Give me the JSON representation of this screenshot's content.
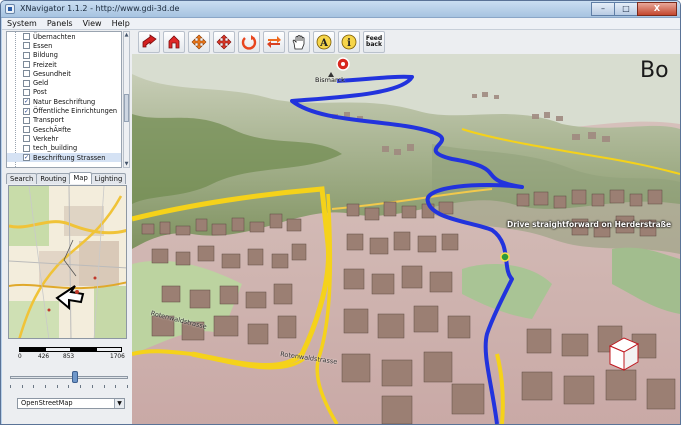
{
  "window": {
    "title": "XNavigator 1.1.2 - http://www.gdi-3d.de",
    "buttons": {
      "minimize": "–",
      "maximize": "□",
      "close": "X"
    }
  },
  "menu": [
    "System",
    "Panels",
    "View",
    "Help"
  ],
  "layers": [
    {
      "label": "Übernachten",
      "checked": false
    },
    {
      "label": "Essen",
      "checked": false
    },
    {
      "label": "Bildung",
      "checked": false
    },
    {
      "label": "Freizeit",
      "checked": false
    },
    {
      "label": "Gesundheit",
      "checked": false
    },
    {
      "label": "Geld",
      "checked": false
    },
    {
      "label": "Post",
      "checked": false
    },
    {
      "label": "Natur Beschriftung",
      "checked": true
    },
    {
      "label": "Öffentliche Einrichtungen",
      "checked": true
    },
    {
      "label": "Transport",
      "checked": false
    },
    {
      "label": "GeschÃ¤fte",
      "checked": false
    },
    {
      "label": "Verkehr",
      "checked": false
    },
    {
      "label": "tech_building",
      "checked": false
    },
    {
      "label": "Beschriftung Strassen",
      "checked": true
    }
  ],
  "tabs": [
    "Search",
    "Routing",
    "Map",
    "Lighting"
  ],
  "active_tab": "Map",
  "scale": {
    "labels": [
      "0",
      "426",
      "853",
      "1706"
    ]
  },
  "slider": {
    "value": 0.55
  },
  "map_source": "OpenStreetMap",
  "toolbar": {
    "buttons": [
      {
        "name": "pan-forward",
        "icon": "red-arrow-icon"
      },
      {
        "name": "pan-up",
        "icon": "red-up-arrow-icon"
      },
      {
        "name": "move",
        "icon": "cross-arrows-icon"
      },
      {
        "name": "move-alt",
        "icon": "cross-arrows-red-icon"
      },
      {
        "name": "rotate",
        "icon": "rotate-icon"
      },
      {
        "name": "swap",
        "icon": "swap-arrows-icon"
      },
      {
        "name": "grab",
        "icon": "hand-icon"
      },
      {
        "name": "annotate",
        "icon": "letter-a-icon"
      },
      {
        "name": "info",
        "icon": "info-icon"
      }
    ],
    "feedback_label": "Feed back"
  },
  "view": {
    "route_instruction": "Drive straightforward on Herderstraße",
    "city_label": "Bo",
    "poi_label": "Bismarck",
    "street_label_1": "Rotenwaldstrasse",
    "street_label_2": "Rotenwaldstrasse",
    "colors": {
      "route": "#2233dd",
      "street": "#f5d21a",
      "building": "#9b7f73"
    }
  },
  "toolbar_letters": {
    "a": "A",
    "i": "i"
  }
}
